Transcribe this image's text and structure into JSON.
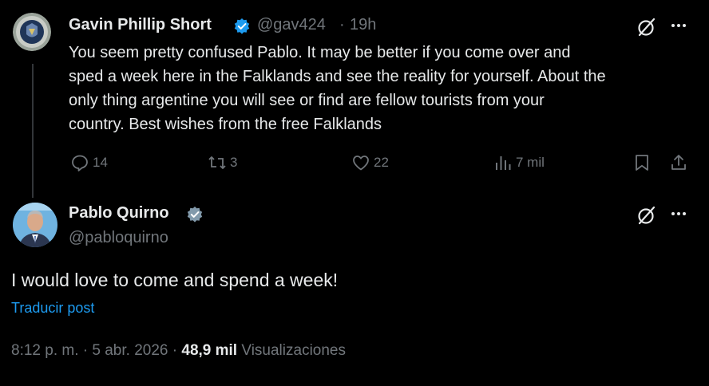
{
  "reply": {
    "author_name": "Gavin Phillip Short",
    "handle": "@gav424",
    "separator": "·",
    "time": "19h",
    "lines": [
      "You seem pretty confused Pablo. It may be better if you come over and",
      "sped a week here in the Falklands and see the reality for yourself. About the",
      "only thing argentine you will see or find are fellow tourists from your",
      "country. Best wishes from the free Falklands"
    ],
    "actions": {
      "replies": "14",
      "reposts": "3",
      "likes": "22",
      "views": "7 mil"
    }
  },
  "main_post": {
    "author_name": "Pablo Quirno",
    "handle": "@pabloquirno",
    "text": "I would love to come and spend a week!",
    "translate_label": "Traducir post",
    "time": "8:12 p. m.",
    "date": "5 abr. 2026",
    "separator": "·",
    "views_count": "48,9 mil",
    "views_label": "Visualizaciones"
  },
  "colors": {
    "background": "#000000",
    "text": "#e7e9ea",
    "muted": "#71767b",
    "link": "#1d9bf0",
    "verified": "#1d9bf0",
    "divider": "#333639"
  },
  "icons": [
    "reply-icon",
    "repost-icon",
    "like-icon",
    "views-icon",
    "bookmark-icon",
    "share-icon",
    "grok-icon",
    "more-icon",
    "verified-icon"
  ]
}
